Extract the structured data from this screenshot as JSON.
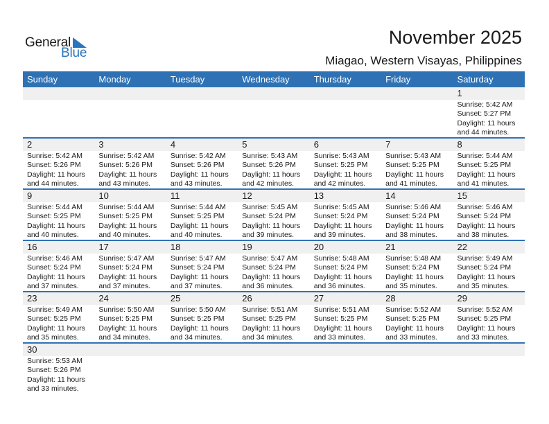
{
  "logo": {
    "word1": "General",
    "word2": "Blue",
    "accent": "#2a75bb"
  },
  "header": {
    "title": "November 2025",
    "location": "Miagao, Western Visayas, Philippines"
  },
  "colors": {
    "header_bg": "#2e72b5",
    "day_number_bg": "#f0f0f0"
  },
  "weekdays": [
    "Sunday",
    "Monday",
    "Tuesday",
    "Wednesday",
    "Thursday",
    "Friday",
    "Saturday"
  ],
  "labels": {
    "sunrise": "Sunrise:",
    "sunset": "Sunset:",
    "daylight": "Daylight:"
  },
  "weeks": [
    [
      null,
      null,
      null,
      null,
      null,
      null,
      {
        "day": "1",
        "sunrise": "Sunrise: 5:42 AM",
        "sunset": "Sunset: 5:27 PM",
        "daylight1": "Daylight: 11 hours",
        "daylight2": "and 44 minutes."
      }
    ],
    [
      {
        "day": "2",
        "sunrise": "Sunrise: 5:42 AM",
        "sunset": "Sunset: 5:26 PM",
        "daylight1": "Daylight: 11 hours",
        "daylight2": "and 44 minutes."
      },
      {
        "day": "3",
        "sunrise": "Sunrise: 5:42 AM",
        "sunset": "Sunset: 5:26 PM",
        "daylight1": "Daylight: 11 hours",
        "daylight2": "and 43 minutes."
      },
      {
        "day": "4",
        "sunrise": "Sunrise: 5:42 AM",
        "sunset": "Sunset: 5:26 PM",
        "daylight1": "Daylight: 11 hours",
        "daylight2": "and 43 minutes."
      },
      {
        "day": "5",
        "sunrise": "Sunrise: 5:43 AM",
        "sunset": "Sunset: 5:26 PM",
        "daylight1": "Daylight: 11 hours",
        "daylight2": "and 42 minutes."
      },
      {
        "day": "6",
        "sunrise": "Sunrise: 5:43 AM",
        "sunset": "Sunset: 5:25 PM",
        "daylight1": "Daylight: 11 hours",
        "daylight2": "and 42 minutes."
      },
      {
        "day": "7",
        "sunrise": "Sunrise: 5:43 AM",
        "sunset": "Sunset: 5:25 PM",
        "daylight1": "Daylight: 11 hours",
        "daylight2": "and 41 minutes."
      },
      {
        "day": "8",
        "sunrise": "Sunrise: 5:44 AM",
        "sunset": "Sunset: 5:25 PM",
        "daylight1": "Daylight: 11 hours",
        "daylight2": "and 41 minutes."
      }
    ],
    [
      {
        "day": "9",
        "sunrise": "Sunrise: 5:44 AM",
        "sunset": "Sunset: 5:25 PM",
        "daylight1": "Daylight: 11 hours",
        "daylight2": "and 40 minutes."
      },
      {
        "day": "10",
        "sunrise": "Sunrise: 5:44 AM",
        "sunset": "Sunset: 5:25 PM",
        "daylight1": "Daylight: 11 hours",
        "daylight2": "and 40 minutes."
      },
      {
        "day": "11",
        "sunrise": "Sunrise: 5:44 AM",
        "sunset": "Sunset: 5:25 PM",
        "daylight1": "Daylight: 11 hours",
        "daylight2": "and 40 minutes."
      },
      {
        "day": "12",
        "sunrise": "Sunrise: 5:45 AM",
        "sunset": "Sunset: 5:24 PM",
        "daylight1": "Daylight: 11 hours",
        "daylight2": "and 39 minutes."
      },
      {
        "day": "13",
        "sunrise": "Sunrise: 5:45 AM",
        "sunset": "Sunset: 5:24 PM",
        "daylight1": "Daylight: 11 hours",
        "daylight2": "and 39 minutes."
      },
      {
        "day": "14",
        "sunrise": "Sunrise: 5:46 AM",
        "sunset": "Sunset: 5:24 PM",
        "daylight1": "Daylight: 11 hours",
        "daylight2": "and 38 minutes."
      },
      {
        "day": "15",
        "sunrise": "Sunrise: 5:46 AM",
        "sunset": "Sunset: 5:24 PM",
        "daylight1": "Daylight: 11 hours",
        "daylight2": "and 38 minutes."
      }
    ],
    [
      {
        "day": "16",
        "sunrise": "Sunrise: 5:46 AM",
        "sunset": "Sunset: 5:24 PM",
        "daylight1": "Daylight: 11 hours",
        "daylight2": "and 37 minutes."
      },
      {
        "day": "17",
        "sunrise": "Sunrise: 5:47 AM",
        "sunset": "Sunset: 5:24 PM",
        "daylight1": "Daylight: 11 hours",
        "daylight2": "and 37 minutes."
      },
      {
        "day": "18",
        "sunrise": "Sunrise: 5:47 AM",
        "sunset": "Sunset: 5:24 PM",
        "daylight1": "Daylight: 11 hours",
        "daylight2": "and 37 minutes."
      },
      {
        "day": "19",
        "sunrise": "Sunrise: 5:47 AM",
        "sunset": "Sunset: 5:24 PM",
        "daylight1": "Daylight: 11 hours",
        "daylight2": "and 36 minutes."
      },
      {
        "day": "20",
        "sunrise": "Sunrise: 5:48 AM",
        "sunset": "Sunset: 5:24 PM",
        "daylight1": "Daylight: 11 hours",
        "daylight2": "and 36 minutes."
      },
      {
        "day": "21",
        "sunrise": "Sunrise: 5:48 AM",
        "sunset": "Sunset: 5:24 PM",
        "daylight1": "Daylight: 11 hours",
        "daylight2": "and 35 minutes."
      },
      {
        "day": "22",
        "sunrise": "Sunrise: 5:49 AM",
        "sunset": "Sunset: 5:24 PM",
        "daylight1": "Daylight: 11 hours",
        "daylight2": "and 35 minutes."
      }
    ],
    [
      {
        "day": "23",
        "sunrise": "Sunrise: 5:49 AM",
        "sunset": "Sunset: 5:25 PM",
        "daylight1": "Daylight: 11 hours",
        "daylight2": "and 35 minutes."
      },
      {
        "day": "24",
        "sunrise": "Sunrise: 5:50 AM",
        "sunset": "Sunset: 5:25 PM",
        "daylight1": "Daylight: 11 hours",
        "daylight2": "and 34 minutes."
      },
      {
        "day": "25",
        "sunrise": "Sunrise: 5:50 AM",
        "sunset": "Sunset: 5:25 PM",
        "daylight1": "Daylight: 11 hours",
        "daylight2": "and 34 minutes."
      },
      {
        "day": "26",
        "sunrise": "Sunrise: 5:51 AM",
        "sunset": "Sunset: 5:25 PM",
        "daylight1": "Daylight: 11 hours",
        "daylight2": "and 34 minutes."
      },
      {
        "day": "27",
        "sunrise": "Sunrise: 5:51 AM",
        "sunset": "Sunset: 5:25 PM",
        "daylight1": "Daylight: 11 hours",
        "daylight2": "and 33 minutes."
      },
      {
        "day": "28",
        "sunrise": "Sunrise: 5:52 AM",
        "sunset": "Sunset: 5:25 PM",
        "daylight1": "Daylight: 11 hours",
        "daylight2": "and 33 minutes."
      },
      {
        "day": "29",
        "sunrise": "Sunrise: 5:52 AM",
        "sunset": "Sunset: 5:25 PM",
        "daylight1": "Daylight: 11 hours",
        "daylight2": "and 33 minutes."
      }
    ],
    [
      {
        "day": "30",
        "sunrise": "Sunrise: 5:53 AM",
        "sunset": "Sunset: 5:26 PM",
        "daylight1": "Daylight: 11 hours",
        "daylight2": "and 33 minutes."
      },
      null,
      null,
      null,
      null,
      null,
      null
    ]
  ]
}
